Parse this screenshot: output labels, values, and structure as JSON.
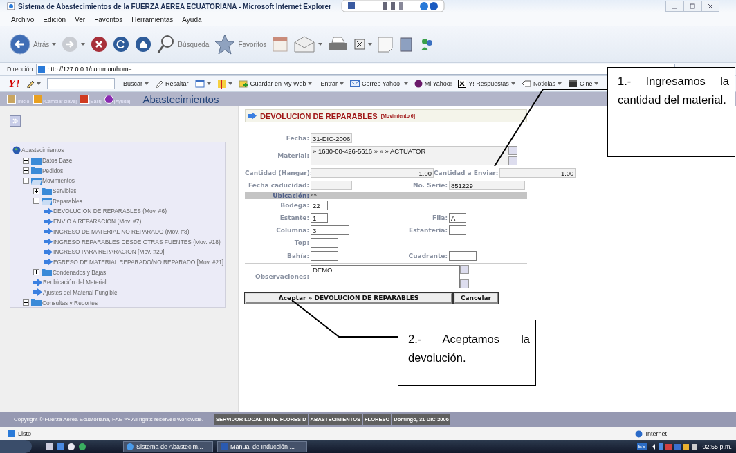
{
  "window": {
    "title": "Sistema de Abastecimientos de la FUERZA AEREA ECUATORIANA - Microsoft Internet Explorer",
    "menu": [
      "Archivo",
      "Edición",
      "Ver",
      "Favoritos",
      "Herramientas",
      "Ayuda"
    ]
  },
  "toolbar": {
    "buttons": [
      {
        "kind": "back",
        "label": "Atrás",
        "dropdown": true
      },
      {
        "kind": "forward",
        "dropdown": true
      },
      {
        "kind": "stop",
        "dropdown": false
      },
      {
        "kind": "refresh",
        "dropdown": false
      },
      {
        "kind": "home",
        "dropdown": false
      },
      {
        "kind": "search",
        "label": "Búsqueda",
        "dropdown": false
      },
      {
        "kind": "favorites",
        "label": "Favoritos",
        "dropdown": false
      },
      {
        "kind": "history",
        "dropdown": false
      },
      {
        "kind": "mail",
        "dropdown": true
      },
      {
        "kind": "print",
        "dropdown": false
      },
      {
        "kind": "edit",
        "dropdown": true
      },
      {
        "kind": "page",
        "dropdown": false
      },
      {
        "kind": "research",
        "dropdown": false
      },
      {
        "kind": "messenger",
        "dropdown": false
      }
    ]
  },
  "address": {
    "label": "Dirección",
    "value": "http://127.0.0.1/common/home"
  },
  "yahoo_bar": {
    "logo": "Y!",
    "items": [
      {
        "kind": "pencil",
        "dropdown": true
      },
      {
        "kind": "field"
      },
      {
        "kind": "plain",
        "label": "Buscar",
        "dropdown": true
      },
      {
        "kind": "highlight",
        "label": "Resaltar",
        "dropdown": false
      },
      {
        "kind": "form",
        "dropdown": true
      },
      {
        "kind": "target",
        "dropdown": true
      },
      {
        "kind": "save",
        "label": "Guardar en My Web",
        "dropdown": true
      },
      {
        "kind": "plain",
        "label": "Entrar",
        "dropdown": true
      },
      {
        "kind": "mail",
        "label": "Correo Yahoo!",
        "dropdown": true
      },
      {
        "kind": "my",
        "label": "Mi Yahoo!",
        "dropdown": false
      },
      {
        "kind": "answers",
        "label": "Y! Respuestas",
        "dropdown": true
      },
      {
        "kind": "tag",
        "label": "Noticias",
        "dropdown": true
      },
      {
        "kind": "film",
        "label": "Cine",
        "dropdown": true
      }
    ]
  },
  "app_header": {
    "links": [
      {
        "kind": "home",
        "label": "[Inicio]"
      },
      {
        "kind": "key",
        "label": "[Cambiar clave]"
      },
      {
        "kind": "exit",
        "label": "[Salir]"
      },
      {
        "kind": "help",
        "label": "[Ayuda]"
      }
    ],
    "title": "Abastecimientos"
  },
  "tree": {
    "kind": "root",
    "label": "Abastecimientos",
    "children": [
      {
        "kind": "folder",
        "label": "Datos Base",
        "expanded": false
      },
      {
        "kind": "folder",
        "label": "Pedidos",
        "expanded": false
      },
      {
        "kind": "folder",
        "label": "Movimientos",
        "expanded": true,
        "children": [
          {
            "kind": "folder",
            "label": "Servibles",
            "expanded": false
          },
          {
            "kind": "folder",
            "label": "Reparables",
            "expanded": true,
            "children": [
              {
                "kind": "link",
                "label": "DEVOLUCION DE REPARABLES (Mov. #6)"
              },
              {
                "kind": "link",
                "label": "ENVIO A REPARACION (Mov. #7)"
              },
              {
                "kind": "link",
                "label": "INGRESO DE MATERIAL NO REPARADO (Mov. #8)"
              },
              {
                "kind": "link",
                "label": "INGRESO REPARABLES DESDE OTRAS FUENTES (Mov. #18)"
              },
              {
                "kind": "link",
                "label": "INGRESO PARA REPARACION [Mov. #20]"
              },
              {
                "kind": "link",
                "label": "EGRESO DE MATERIAL REPARADO/NO REPARADO [Mov. #21]"
              }
            ]
          },
          {
            "kind": "folder",
            "label": "Condenados y Bajas",
            "expanded": false
          },
          {
            "kind": "link",
            "label": "Reubicación del Material"
          },
          {
            "kind": "link",
            "label": "Ajustes del Material Fungible"
          }
        ]
      },
      {
        "kind": "folder",
        "label": "Consultas y Reportes",
        "expanded": false
      }
    ]
  },
  "form": {
    "title": "DEVOLUCION DE REPARABLES",
    "subtitle": "[Movimiento 6]",
    "rows": [
      {
        "kind": "fields",
        "fields": [
          {
            "label": "Fecha:",
            "value": "31-DIC-2006",
            "readonly": true
          }
        ]
      },
      {
        "kind": "area",
        "fields": [
          {
            "label": "Material:",
            "value": "» 1680-00-426-5616 » » » ACTUATOR",
            "readonly": true
          }
        ]
      },
      {
        "kind": "fields",
        "fields": [
          {
            "label": "Cantidad (Hangar):",
            "value": "1.00",
            "readonly": true
          },
          {
            "label": "Cantidad a Enviar:",
            "value": "1.00",
            "readonly": true
          }
        ]
      },
      {
        "kind": "fields",
        "fields": [
          {
            "label": "Fecha caducidad:",
            "readonly": true
          },
          {
            "label": "No. Serie:",
            "value": "851229",
            "readonly": true
          }
        ]
      },
      {
        "kind": "section",
        "label": "Ubicación:",
        "value": "»»"
      },
      {
        "kind": "fields",
        "fields": [
          {
            "label": "Bodega:",
            "value": "22",
            "readonly": false
          }
        ]
      },
      {
        "kind": "fields",
        "fields": [
          {
            "label": "Estante:",
            "value": "1",
            "readonly": false
          },
          {
            "label": "Fila:",
            "value": "A",
            "readonly": false
          }
        ]
      },
      {
        "kind": "fields",
        "fields": [
          {
            "label": "Columna:",
            "value": "3",
            "readonly": false
          },
          {
            "label": "Estantería:",
            "readonly": false
          }
        ]
      },
      {
        "kind": "fields",
        "fields": [
          {
            "label": "Top:",
            "readonly": false
          }
        ]
      },
      {
        "kind": "fields",
        "fields": [
          {
            "label": "Bahía:",
            "readonly": false
          },
          {
            "label": "Cuadrante:",
            "readonly": false
          }
        ]
      },
      {
        "kind": "area",
        "fields": [
          {
            "label": "Observaciones:",
            "value": "DEMO",
            "readonly": false
          }
        ]
      }
    ],
    "buttons": [
      "Aceptar » DEVOLUCION DE REPARABLES",
      "Cancelar"
    ]
  },
  "footer": {
    "copyright": "Copyright © Fuerza Aérea Ecuatoriana, FAE »» All rights reserved worldwide.",
    "segments": [
      "SERVIDOR LOCAL TNTE. FLORES D",
      "ABASTECIMIENTOS",
      "FLORESO",
      "Domingo, 31-DIC-2006"
    ]
  },
  "status_bar": {
    "text": "Listo",
    "zone": "Internet"
  },
  "taskbar": {
    "tasks": [
      {
        "kind": "ie",
        "label": "Sistema de Abastecim..."
      },
      {
        "kind": "word",
        "label": "Manual de Inducción ..."
      }
    ],
    "language": "ES",
    "clock": "02:55 p.m."
  },
  "callouts": [
    {
      "text": "1.- Ingresamos la cantidad del material."
    },
    {
      "text": "2.- Aceptamos la devolución."
    }
  ]
}
